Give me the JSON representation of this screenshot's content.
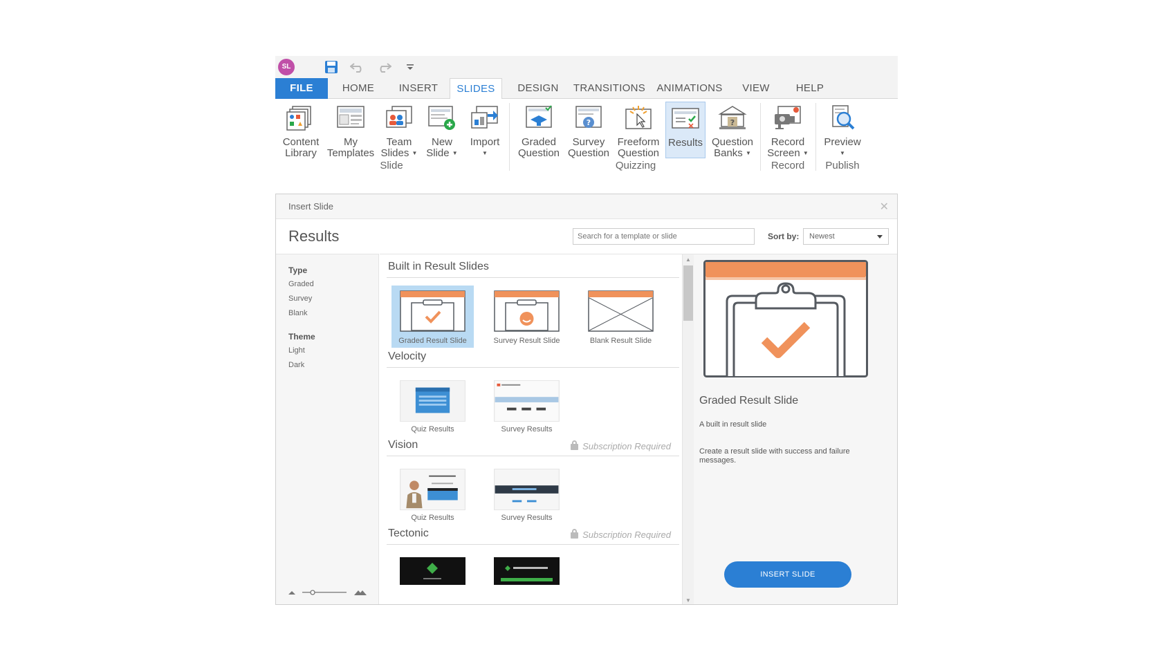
{
  "quick_access": {
    "avatar_initials": "SL",
    "save": "save-icon",
    "undo": "undo-icon",
    "redo": "redo-icon",
    "customize": "chevron-down-icon"
  },
  "tabs": [
    {
      "label": "FILE"
    },
    {
      "label": "HOME"
    },
    {
      "label": "INSERT"
    },
    {
      "label": "SLIDES"
    },
    {
      "label": "DESIGN"
    },
    {
      "label": "TRANSITIONS"
    },
    {
      "label": "ANIMATIONS"
    },
    {
      "label": "VIEW"
    },
    {
      "label": "HELP"
    }
  ],
  "active_tab": "SLIDES",
  "ribbon": {
    "buttons": [
      {
        "label": "Content\nLibrary"
      },
      {
        "label": "My\nTemplates"
      },
      {
        "label": "Team\nSlides"
      },
      {
        "label": "New\nSlide"
      },
      {
        "label": "Import"
      },
      {
        "label": "Graded\nQuestion"
      },
      {
        "label": "Survey\nQuestion"
      },
      {
        "label": "Freeform\nQuestion"
      },
      {
        "label": "Results"
      },
      {
        "label": "Question\nBanks"
      },
      {
        "label": "Record\nScreen"
      },
      {
        "label": "Preview"
      }
    ],
    "groups": {
      "slide": "Slide",
      "quizzing": "Quizzing",
      "record": "Record",
      "publish": "Publish"
    }
  },
  "dialog": {
    "title": "Insert Slide",
    "heading": "Results",
    "search_placeholder": "Search for a template or slide",
    "sort_label": "Sort by:",
    "sort_value": "Newest",
    "filters": {
      "type_heading": "Type",
      "type_items": [
        "Graded",
        "Survey",
        "Blank"
      ],
      "theme_heading": "Theme",
      "theme_items": [
        "Light",
        "Dark"
      ]
    },
    "sections": [
      {
        "title": "Built in Result Slides",
        "items": [
          "Graded Result Slide",
          "Survey Result Slide",
          "Blank Result Slide"
        ]
      },
      {
        "title": "Velocity",
        "items": [
          "Quiz Results",
          "Survey Results"
        ]
      },
      {
        "title": "Vision",
        "subscription": "Subscription Required",
        "items": [
          "Quiz Results",
          "Survey Results"
        ]
      },
      {
        "title": "Tectonic",
        "subscription": "Subscription Required",
        "items": []
      }
    ],
    "preview": {
      "title": "Graded Result Slide",
      "subtitle": "A built in result slide",
      "description": "Create a result slide with success and failure messages.",
      "button": "INSERT SLIDE"
    }
  },
  "colors": {
    "accent": "#2b7fd4",
    "slide_orange": "#f0925b",
    "slide_outline": "#555a60",
    "avatar": "#c04fa8"
  }
}
